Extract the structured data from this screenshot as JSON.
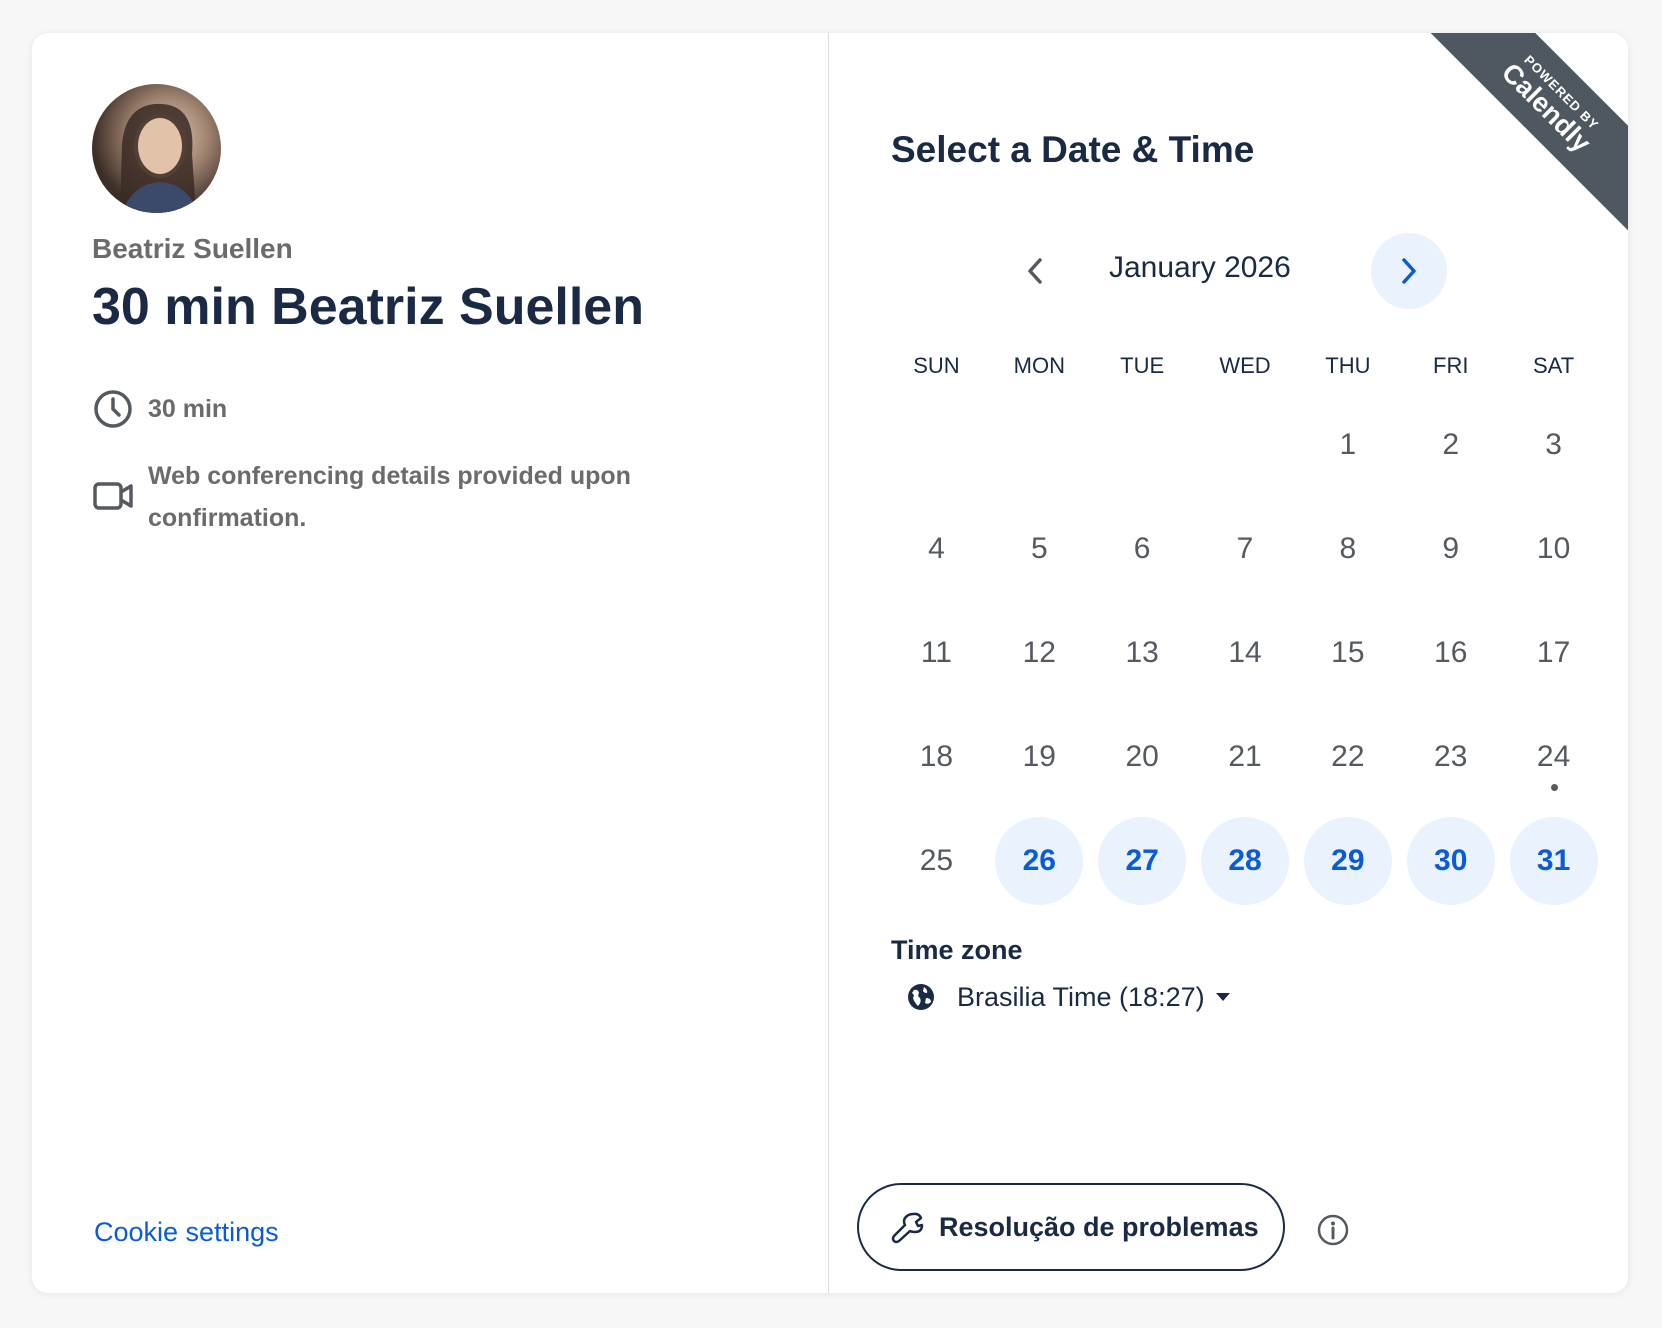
{
  "host": {
    "name": "Beatriz Suellen"
  },
  "event": {
    "title": "30 min Beatriz Suellen",
    "duration": "30 min",
    "conferencing": "Web conferencing details provided upon confirmation."
  },
  "footer": {
    "cookie_settings": "Cookie settings"
  },
  "scheduler": {
    "title": "Select a Date & Time",
    "month_label": "January 2026",
    "prev_icon": "chevron-left-icon",
    "next_icon": "chevron-right-icon",
    "weekdays": [
      "SUN",
      "MON",
      "TUE",
      "WED",
      "THU",
      "FRI",
      "SAT"
    ],
    "weeks": [
      [
        null,
        null,
        null,
        null,
        "1",
        "2",
        "3"
      ],
      [
        "4",
        "5",
        "6",
        "7",
        "8",
        "9",
        "10"
      ],
      [
        "11",
        "12",
        "13",
        "14",
        "15",
        "16",
        "17"
      ],
      [
        "18",
        "19",
        "20",
        "21",
        "22",
        "23",
        "24"
      ],
      [
        "25",
        "26",
        "27",
        "28",
        "29",
        "30",
        "31"
      ]
    ],
    "available_days": [
      "26",
      "27",
      "28",
      "29",
      "30",
      "31"
    ],
    "today": "24"
  },
  "timezone": {
    "label": "Time zone",
    "value": "Brasilia Time (18:27)"
  },
  "troubleshoot": {
    "label": "Resolução de problemas"
  },
  "badge": {
    "small": "POWERED BY",
    "big": "Calendly"
  },
  "colors": {
    "accent": "#0b5cd4",
    "available_bg": "#eaf2fd",
    "text_dark": "#1a2a44",
    "text_muted": "#6b6b6b",
    "ribbon": "#4f5861"
  }
}
